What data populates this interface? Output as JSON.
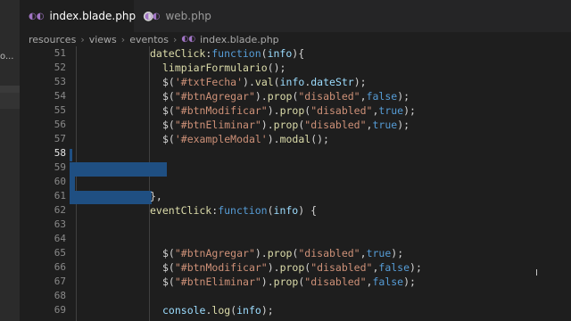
{
  "activity": {
    "partial_label": "o..."
  },
  "tabs": [
    {
      "label": "index.blade.php",
      "icon": "php-icon",
      "modified": true,
      "active": true
    },
    {
      "label": "web.php",
      "icon": "php-icon",
      "modified": false,
      "active": false
    }
  ],
  "breadcrumb": [
    "resources",
    "views",
    "eventos",
    "index.blade.php"
  ],
  "editor": {
    "line_numbers": [
      "51",
      "52",
      "53",
      "54",
      "55",
      "56",
      "57",
      "58",
      "59",
      "60",
      "61",
      "62",
      "63",
      "64",
      "65",
      "66",
      "67",
      "68",
      "69"
    ],
    "active_line": "58",
    "code": {
      "l51": {
        "name": "dateClick",
        "colon": ":",
        "kw": "function",
        "open": "(",
        "param": "info",
        "close": "){"
      },
      "l52": {
        "call": "limpiarFormulario",
        "rest": "();"
      },
      "l53": {
        "a": "$(",
        "s": "'#txtFecha'",
        "b": ").",
        "m": "val",
        "c": "(",
        "v": "info",
        "d": ".",
        "p": "dateStr",
        "e": ");"
      },
      "l54": {
        "a": "$(",
        "s": "\"#btnAgregar\"",
        "b": ").",
        "m": "prop",
        "c": "(",
        "s2": "\"disabled\"",
        "d": ",",
        "bool": "false",
        "e": ");"
      },
      "l55": {
        "a": "$(",
        "s": "\"#btnModificar\"",
        "b": ").",
        "m": "prop",
        "c": "(",
        "s2": "\"disabled\"",
        "d": ",",
        "bool": "true",
        "e": ");"
      },
      "l56": {
        "a": "$(",
        "s": "\"#btnEliminar\"",
        "b": ").",
        "m": "prop",
        "c": "(",
        "s2": "\"disabled\"",
        "d": ",",
        "bool": "true",
        "e": ");"
      },
      "l57": {
        "a": "$(",
        "s": "'#exampleModal'",
        "b": ").",
        "m": "modal",
        "e": "();"
      },
      "l61": {
        "text": "},"
      },
      "l62": {
        "name": "eventClick",
        "colon": ":",
        "kw": "function",
        "open": "(",
        "param": "info",
        "close": ") {"
      },
      "l65": {
        "a": "$(",
        "s": "\"#btnAgregar\"",
        "b": ").",
        "m": "prop",
        "c": "(",
        "s2": "\"disabled\"",
        "d": ",",
        "bool": "true",
        "e": ");"
      },
      "l66": {
        "a": "$(",
        "s": "\"#btnModificar\"",
        "b": ").",
        "m": "prop",
        "c": "(",
        "s2": "\"disabled\"",
        "d": ",",
        "bool": "false",
        "e": ");"
      },
      "l67": {
        "a": "$(",
        "s": "\"#btnEliminar\"",
        "b": ").",
        "m": "prop",
        "c": "(",
        "s2": "\"disabled\"",
        "d": ",",
        "bool": "false",
        "e": ");"
      },
      "l69": {
        "v": "console",
        "d": ".",
        "m": "log",
        "c": "(",
        "p": "info",
        "e": ");"
      }
    }
  },
  "colors": {
    "background": "#1e1e1e",
    "selection": "#1f4f82",
    "keyword": "#569cd6",
    "function": "#dcdcaa",
    "string": "#ce9178",
    "variable": "#9cdcfe"
  }
}
